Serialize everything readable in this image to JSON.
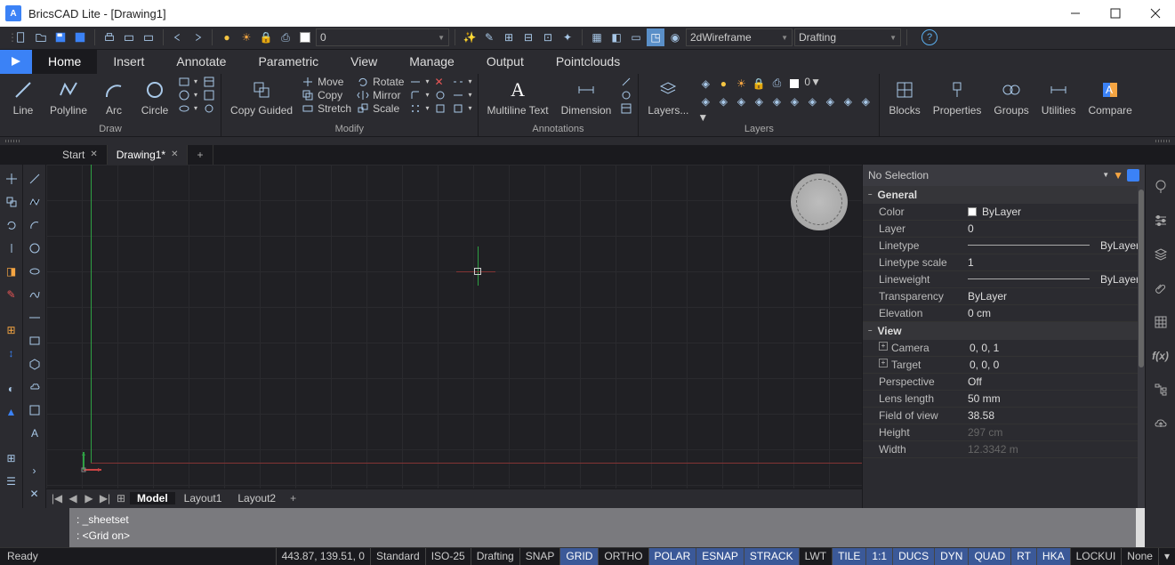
{
  "app": {
    "title": "BricsCAD Lite - [Drawing1]"
  },
  "qat": {
    "layer_combo": "0",
    "visual_style": "2dWireframe",
    "workspace": "Drafting"
  },
  "menu": {
    "tabs": [
      "Home",
      "Insert",
      "Annotate",
      "Parametric",
      "View",
      "Manage",
      "Output",
      "Pointclouds"
    ],
    "active": "Home"
  },
  "ribbon": {
    "draw": {
      "label": "Draw",
      "line": "Line",
      "polyline": "Polyline",
      "arc": "Arc",
      "circle": "Circle"
    },
    "modify": {
      "label": "Modify",
      "copy_guided": "Copy Guided",
      "move": "Move",
      "copy": "Copy",
      "stretch": "Stretch",
      "rotate": "Rotate",
      "mirror": "Mirror",
      "scale": "Scale"
    },
    "annotations": {
      "label": "Annotations",
      "multiline_text": "Multiline Text",
      "dimension": "Dimension"
    },
    "layers": {
      "label": "Layers",
      "btn": "Layers...",
      "combo": "0"
    },
    "blocks": "Blocks",
    "properties": "Properties",
    "groups": "Groups",
    "utilities": "Utilities",
    "compare": "Compare"
  },
  "filetabs": {
    "start": "Start",
    "drawing": "Drawing1*"
  },
  "layouttabs": {
    "model": "Model",
    "layout1": "Layout1",
    "layout2": "Layout2"
  },
  "props": {
    "selection": "No Selection",
    "sections": {
      "general": {
        "label": "General",
        "color_k": "Color",
        "color_v": "ByLayer",
        "layer_k": "Layer",
        "layer_v": "0",
        "linetype_k": "Linetype",
        "linetype_v": "ByLayer",
        "ltscale_k": "Linetype scale",
        "ltscale_v": "1",
        "lweight_k": "Lineweight",
        "lweight_v": "ByLayer",
        "transp_k": "Transparency",
        "transp_v": "ByLayer",
        "elev_k": "Elevation",
        "elev_v": "0 cm"
      },
      "view": {
        "label": "View",
        "camera_k": "Camera",
        "camera_v": "0, 0, 1",
        "target_k": "Target",
        "target_v": "0, 0, 0",
        "persp_k": "Perspective",
        "persp_v": "Off",
        "lens_k": "Lens length",
        "lens_v": "50 mm",
        "fov_k": "Field of view",
        "fov_v": "38.58",
        "height_k": "Height",
        "height_v": "297 cm",
        "width_k": "Width",
        "width_v": "12.3342 m"
      }
    }
  },
  "cmd": {
    "line1": ": _sheetset",
    "line2": ": <Grid on>"
  },
  "status": {
    "ready": "Ready",
    "coords": "443.87, 139.51, 0",
    "std": "Standard",
    "iso": "ISO-25",
    "drafting": "Drafting",
    "toggles": [
      "SNAP",
      "GRID",
      "ORTHO",
      "POLAR",
      "ESNAP",
      "STRACK",
      "LWT",
      "TILE",
      "1:1",
      "DUCS",
      "DYN",
      "QUAD",
      "RT",
      "HKA",
      "LOCKUI",
      "None"
    ],
    "active_toggles": [
      "GRID",
      "POLAR",
      "ESNAP",
      "STRACK",
      "TILE",
      "1:1",
      "DUCS",
      "DYN",
      "QUAD",
      "RT",
      "HKA"
    ]
  }
}
